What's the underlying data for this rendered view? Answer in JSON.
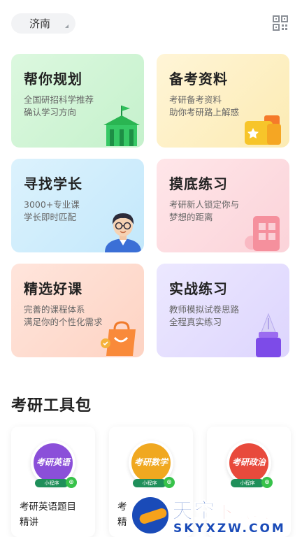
{
  "header": {
    "city": "济南",
    "qr_icon": "qr-code-icon"
  },
  "cards": [
    {
      "title": "帮你规划",
      "desc_line1": "全国研招科学推荐",
      "desc_line2": "确认学习方向",
      "icon": "school-building-icon"
    },
    {
      "title": "备考资料",
      "desc_line1": "考研备考资料",
      "desc_line2": "助你考研路上解惑",
      "icon": "document-folder-icon"
    },
    {
      "title": "寻找学长",
      "desc_line1": "3000+专业课",
      "desc_line2": "学长即时匹配",
      "icon": "senior-avatar-icon"
    },
    {
      "title": "摸底练习",
      "desc_line1": "考研新人锁定你与",
      "desc_line2": "梦想的距离",
      "icon": "practice-book-icon"
    },
    {
      "title": "精选好课",
      "desc_line1": "完善的课程体系",
      "desc_line2": "满足你的个性化需求",
      "icon": "shopping-bag-icon"
    },
    {
      "title": "实战练习",
      "desc_line1": "教师模拟试卷思路",
      "desc_line2": "全程真实练习",
      "icon": "pen-nib-icon"
    }
  ],
  "section": {
    "title": "考研工具包"
  },
  "tools": [
    {
      "badge": "考研英语",
      "badge_base": "小程序",
      "label_line1": "考研英语题目",
      "label_line2": "精讲",
      "color": "#8b4fd9"
    },
    {
      "badge": "考研数学",
      "badge_base": "小程序",
      "label_line1": "考",
      "label_line2": "精",
      "color": "#f0a820"
    },
    {
      "badge": "考研政治",
      "badge_base": "小程序",
      "label_line1": "",
      "label_line2": "",
      "color": "#e84a3c"
    }
  ],
  "watermark": {
    "main": "天空",
    "main_red": "下载玩",
    "sub": "SKYXZW.COM"
  }
}
